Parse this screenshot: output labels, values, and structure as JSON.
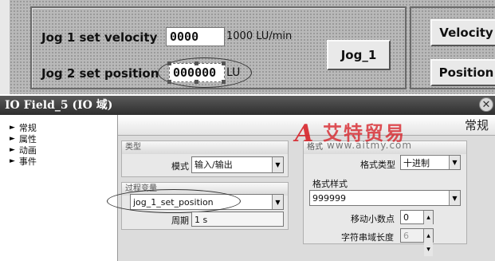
{
  "hmi": {
    "jog1_label": "Jog 1 set velocity",
    "jog1_value": "0000",
    "jog1_unit": "1000 LU/min",
    "jog2_label": "Jog 2 set position",
    "jog2_value": "000000",
    "jog2_unit": "LU",
    "jog_button": "Jog_1",
    "velocity_button": "Velocity",
    "position_button": "Position"
  },
  "dialog": {
    "title": "IO Field_5 (IO 域)",
    "section_title": "常规",
    "nav": [
      "常规",
      "属性",
      "动画",
      "事件"
    ],
    "type_group": {
      "title": "类型",
      "mode_label": "模式",
      "mode_value": "输入/输出"
    },
    "tag_group": {
      "title": "过程变量",
      "tag_value": "jog_1_set_position",
      "cycle_label": "周期",
      "cycle_value": "1 s"
    },
    "format_group": {
      "title": "格式",
      "format_type_label": "格式类型",
      "format_type_value": "十进制",
      "pattern_title": "格式样式",
      "pattern_value": "999999",
      "decimal_label": "移动小数点",
      "decimal_value": "0",
      "length_label": "字符串域长度",
      "length_value": "6"
    }
  },
  "watermark": {
    "logo": "A",
    "text": "艾特贸易",
    "url": "www.aitmy.com"
  }
}
